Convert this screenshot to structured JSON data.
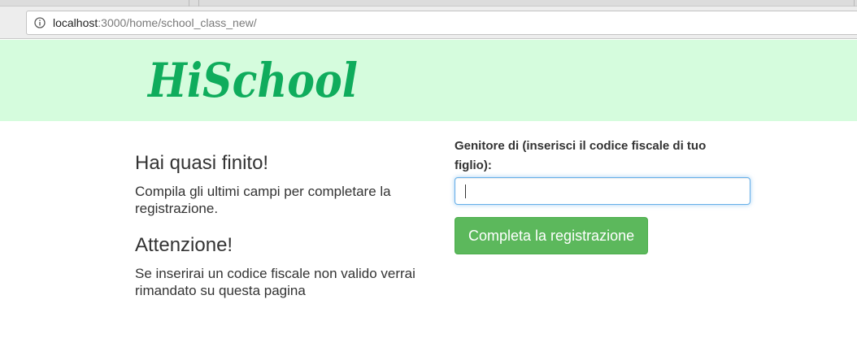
{
  "browser": {
    "url_host": "localhost",
    "url_path": ":3000/home/school_class_new/",
    "info_icon": "info-icon"
  },
  "header": {
    "logo_text": "HiSchool",
    "colors": {
      "background": "#d5fcdd",
      "logo": "#0fac5c"
    }
  },
  "intro": {
    "title": "Hai quasi finito!",
    "text": "Compila gli ultimi campi per completare la registrazione."
  },
  "warning": {
    "title": "Attenzione!",
    "text": "Se inserirai un codice fiscale non valido verrai rimandato su questa pagina"
  },
  "form": {
    "label": "Genitore di (inserisci il codice fiscale di tuo figlio):",
    "input_value": "",
    "submit_label": "Completa la registrazione",
    "colors": {
      "button": "#5cb85c",
      "focus": "#66afe9"
    }
  }
}
